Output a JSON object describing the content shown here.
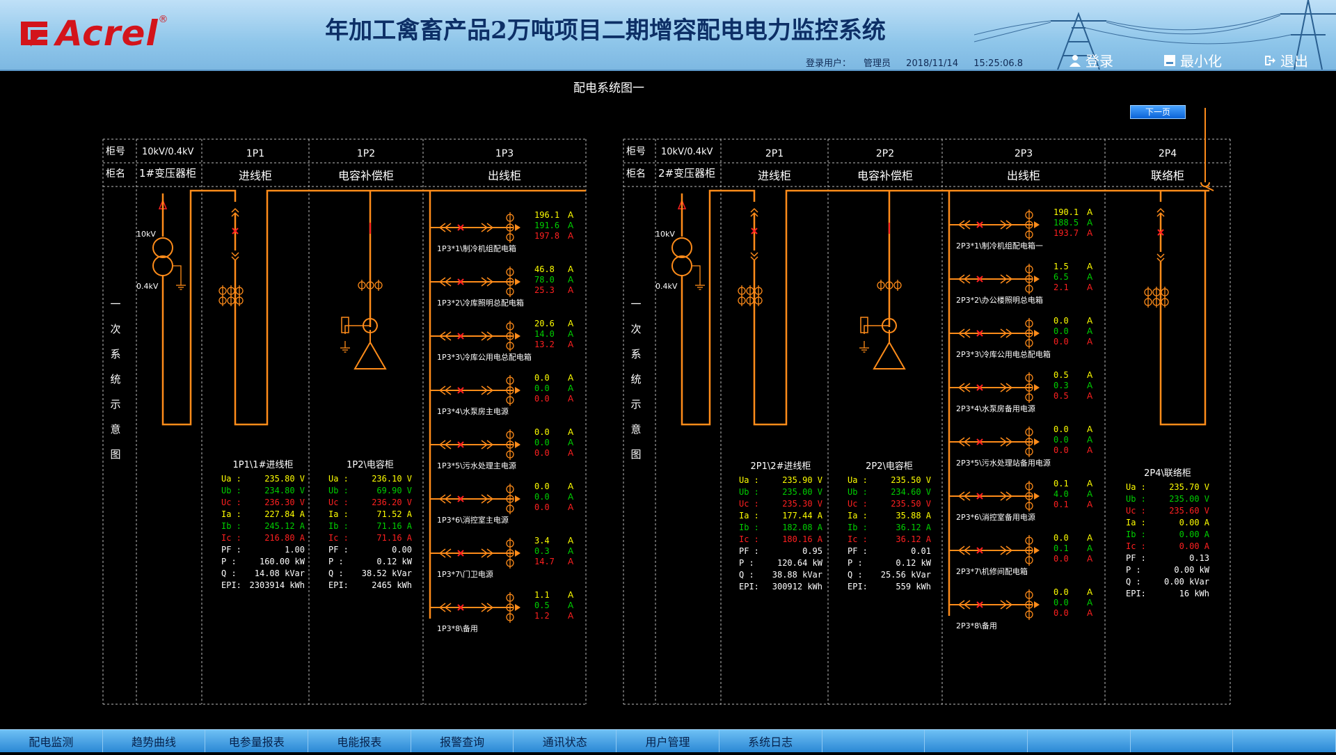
{
  "header": {
    "logo_text": "Acrel",
    "logo_reg": "®",
    "title": "年加工禽畜产品2万吨项目二期增容配电电力监控系统",
    "user_label": "登录用户：",
    "user": "管理员",
    "date": "2018/11/14",
    "time": "15:25:06.8",
    "login": "登录",
    "minimize": "最小化",
    "exit": "退出"
  },
  "diagram_title": "配电系统图一",
  "next_page": "下一页",
  "common": {
    "row_cabinet_no": "柜号",
    "row_cabinet_name": "柜名",
    "vertical_label": "一次系统示意图",
    "kv10": "10kV",
    "kv04": "0.4kV",
    "unit_a": "A"
  },
  "left": {
    "transformer_no": "10kV/0.4kV",
    "transformer_name": "1#变压器柜",
    "cols": [
      {
        "no": "1P1",
        "name": "进线柜"
      },
      {
        "no": "1P2",
        "name": "电容补偿柜"
      },
      {
        "no": "1P3",
        "name": "出线柜"
      }
    ],
    "meters": [
      {
        "title": "1P1\\1#进线柜",
        "rows": [
          {
            "k": "Ua :",
            "v": "235.80 V",
            "c": "#ffff00"
          },
          {
            "k": "Ub :",
            "v": "234.80 V",
            "c": "#00d000"
          },
          {
            "k": "Uc :",
            "v": "236.30 V",
            "c": "#ff2020"
          },
          {
            "k": "Ia :",
            "v": "227.84 A",
            "c": "#ffff00"
          },
          {
            "k": "Ib :",
            "v": "245.12 A",
            "c": "#00d000"
          },
          {
            "k": "Ic :",
            "v": "216.80 A",
            "c": "#ff2020"
          },
          {
            "k": "PF :",
            "v": "1.00",
            "c": "#ffffff"
          },
          {
            "k": "P  :",
            "v": "160.00 kW",
            "c": "#ffffff"
          },
          {
            "k": "Q  :",
            "v": "14.08 kVar",
            "c": "#ffffff"
          },
          {
            "k": "EPI:",
            "v": "2303914 kWh",
            "c": "#ffffff"
          }
        ]
      },
      {
        "title": "1P2\\电容柜",
        "rows": [
          {
            "k": "Ua :",
            "v": "236.10 V",
            "c": "#ffff00"
          },
          {
            "k": "Ub :",
            "v": "69.90 V",
            "c": "#00d000"
          },
          {
            "k": "Uc :",
            "v": "236.20 V",
            "c": "#ff2020"
          },
          {
            "k": "Ia :",
            "v": "71.52 A",
            "c": "#ffff00"
          },
          {
            "k": "Ib :",
            "v": "71.16 A",
            "c": "#00d000"
          },
          {
            "k": "Ic :",
            "v": "71.16 A",
            "c": "#ff2020"
          },
          {
            "k": "PF :",
            "v": "0.00",
            "c": "#ffffff"
          },
          {
            "k": "P  :",
            "v": "0.12 kW",
            "c": "#ffffff"
          },
          {
            "k": "Q  :",
            "v": "38.52 kVar",
            "c": "#ffffff"
          },
          {
            "k": "EPI:",
            "v": "2465 kWh",
            "c": "#ffffff"
          }
        ]
      }
    ],
    "feeders": [
      {
        "name": "1P3*1\\制冷机组配电箱",
        "ia": "196.1",
        "ib": "191.6",
        "ic": "197.8"
      },
      {
        "name": "1P3*2\\冷库照明总配电箱",
        "ia": "46.8",
        "ib": "78.0",
        "ic": "25.3"
      },
      {
        "name": "1P3*3\\冷库公用电总配电箱",
        "ia": "20.6",
        "ib": "14.0",
        "ic": "13.2"
      },
      {
        "name": "1P3*4\\水泵房主电源",
        "ia": "0.0",
        "ib": "0.0",
        "ic": "0.0"
      },
      {
        "name": "1P3*5\\污水处理主电源",
        "ia": "0.0",
        "ib": "0.0",
        "ic": "0.0"
      },
      {
        "name": "1P3*6\\消控室主电源",
        "ia": "0.0",
        "ib": "0.0",
        "ic": "0.0"
      },
      {
        "name": "1P3*7\\门卫电源",
        "ia": "3.4",
        "ib": "0.3",
        "ic": "14.7"
      },
      {
        "name": "1P3*8\\备用",
        "ia": "1.1",
        "ib": "0.5",
        "ic": "1.2"
      }
    ]
  },
  "right": {
    "transformer_no": "10kV/0.4kV",
    "transformer_name": "2#变压器柜",
    "cols": [
      {
        "no": "2P1",
        "name": "进线柜"
      },
      {
        "no": "2P2",
        "name": "电容补偿柜"
      },
      {
        "no": "2P3",
        "name": "出线柜"
      },
      {
        "no": "2P4",
        "name": "联络柜"
      }
    ],
    "meters": [
      {
        "title": "2P1\\2#进线柜",
        "rows": [
          {
            "k": "Ua :",
            "v": "235.90 V",
            "c": "#ffff00"
          },
          {
            "k": "Ub :",
            "v": "235.00 V",
            "c": "#00d000"
          },
          {
            "k": "Uc :",
            "v": "235.30 V",
            "c": "#ff2020"
          },
          {
            "k": "Ia :",
            "v": "177.44 A",
            "c": "#ffff00"
          },
          {
            "k": "Ib :",
            "v": "182.08 A",
            "c": "#00d000"
          },
          {
            "k": "Ic :",
            "v": "180.16 A",
            "c": "#ff2020"
          },
          {
            "k": "PF :",
            "v": "0.95",
            "c": "#ffffff"
          },
          {
            "k": "P  :",
            "v": "120.64 kW",
            "c": "#ffffff"
          },
          {
            "k": "Q  :",
            "v": "38.88 kVar",
            "c": "#ffffff"
          },
          {
            "k": "EPI:",
            "v": "300912 kWh",
            "c": "#ffffff"
          }
        ]
      },
      {
        "title": "2P2\\电容柜",
        "rows": [
          {
            "k": "Ua :",
            "v": "235.50 V",
            "c": "#ffff00"
          },
          {
            "k": "Ub :",
            "v": "234.60 V",
            "c": "#00d000"
          },
          {
            "k": "Uc :",
            "v": "235.50 V",
            "c": "#ff2020"
          },
          {
            "k": "Ia :",
            "v": "35.88 A",
            "c": "#ffff00"
          },
          {
            "k": "Ib :",
            "v": "36.12 A",
            "c": "#00d000"
          },
          {
            "k": "Ic :",
            "v": "36.12 A",
            "c": "#ff2020"
          },
          {
            "k": "PF :",
            "v": "0.01",
            "c": "#ffffff"
          },
          {
            "k": "P  :",
            "v": "0.12 kW",
            "c": "#ffffff"
          },
          {
            "k": "Q  :",
            "v": "25.56 kVar",
            "c": "#ffffff"
          },
          {
            "k": "EPI:",
            "v": "559 kWh",
            "c": "#ffffff"
          }
        ]
      },
      {
        "title": "2P4\\联络柜",
        "rows": [
          {
            "k": "Ua :",
            "v": "235.70 V",
            "c": "#ffff00"
          },
          {
            "k": "Ub :",
            "v": "235.00 V",
            "c": "#00d000"
          },
          {
            "k": "Uc :",
            "v": "235.60 V",
            "c": "#ff2020"
          },
          {
            "k": "Ia :",
            "v": "0.00 A",
            "c": "#ffff00"
          },
          {
            "k": "Ib :",
            "v": "0.00 A",
            "c": "#00d000"
          },
          {
            "k": "Ic :",
            "v": "0.00 A",
            "c": "#ff2020"
          },
          {
            "k": "PF :",
            "v": "0.13",
            "c": "#ffffff"
          },
          {
            "k": "P  :",
            "v": "0.00 kW",
            "c": "#ffffff"
          },
          {
            "k": "Q  :",
            "v": "0.00 kVar",
            "c": "#ffffff"
          },
          {
            "k": "EPI:",
            "v": "16 kWh",
            "c": "#ffffff"
          }
        ]
      }
    ],
    "feeders": [
      {
        "name": "2P3*1\\制冷机组配电箱一",
        "ia": "190.1",
        "ib": "188.5",
        "ic": "193.7"
      },
      {
        "name": "2P3*2\\办公楼照明总电箱",
        "ia": "1.5",
        "ib": "6.5",
        "ic": "2.1"
      },
      {
        "name": "2P3*3\\冷库公用电总配电箱",
        "ia": "0.0",
        "ib": "0.0",
        "ic": "0.0"
      },
      {
        "name": "2P3*4\\水泵房备用电源",
        "ia": "0.5",
        "ib": "0.3",
        "ic": "0.5"
      },
      {
        "name": "2P3*5\\污水处理站备用电源",
        "ia": "0.0",
        "ib": "0.0",
        "ic": "0.0"
      },
      {
        "name": "2P3*6\\消控室备用电源",
        "ia": "0.1",
        "ib": "4.0",
        "ic": "0.1"
      },
      {
        "name": "2P3*7\\机修间配电箱",
        "ia": "0.0",
        "ib": "0.1",
        "ic": "0.0"
      },
      {
        "name": "2P3*8\\备用",
        "ia": "0.0",
        "ib": "0.0",
        "ic": "0.0"
      }
    ]
  },
  "footer": {
    "tabs": [
      "配电监测",
      "趋势曲线",
      "电参量报表",
      "电能报表",
      "报警查询",
      "通讯状态",
      "用户管理",
      "系统日志"
    ]
  },
  "colors": {
    "line": "#ff8c1a",
    "phase_a": "#ffff00",
    "phase_b": "#00d000",
    "phase_c": "#ff2020",
    "breaker": "#ff2020"
  }
}
